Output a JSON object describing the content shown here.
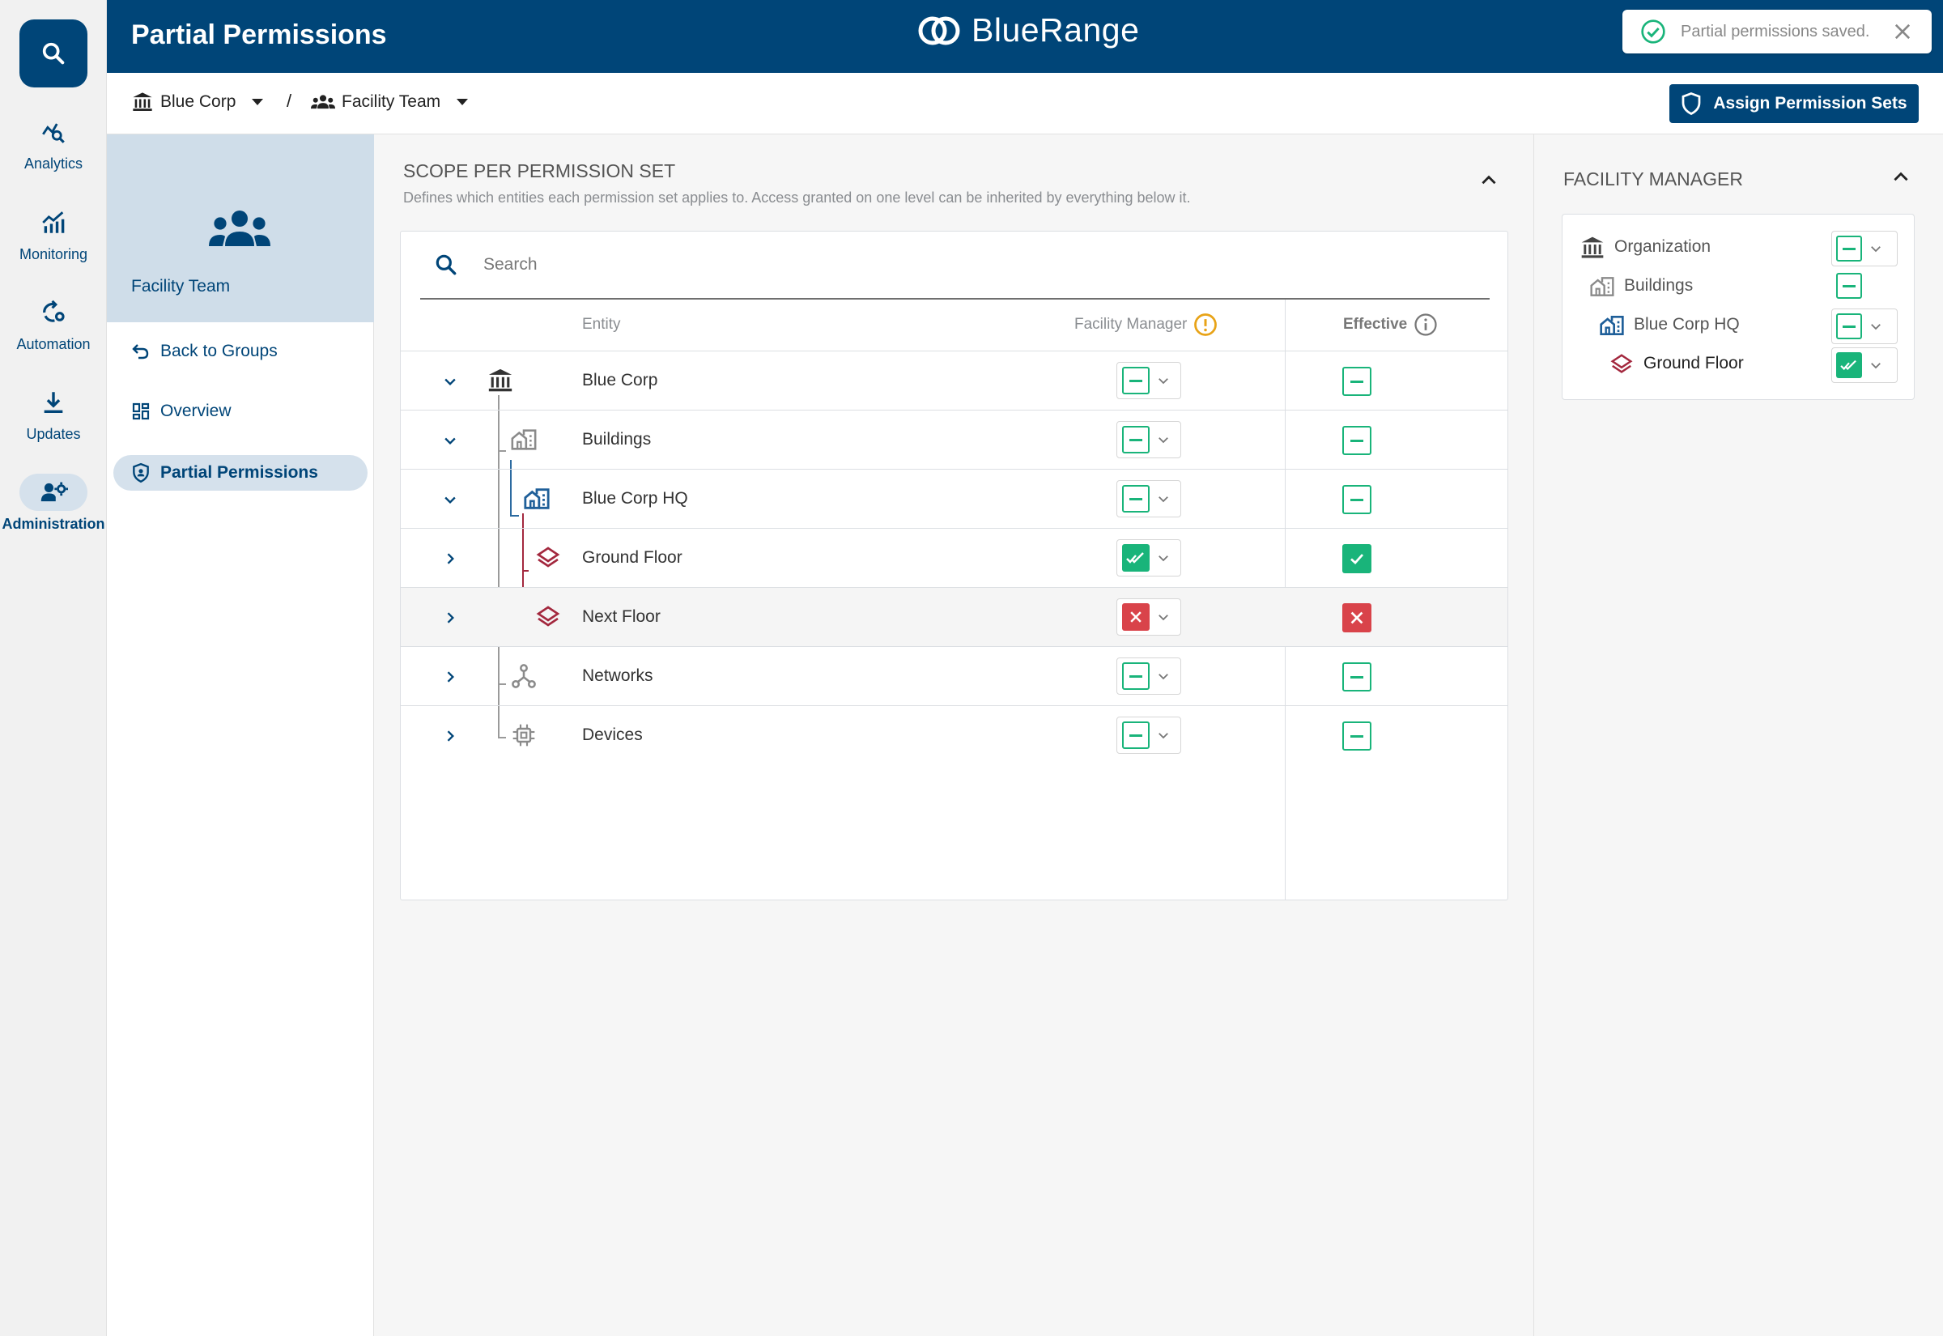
{
  "header": {
    "title": "Partial Permissions",
    "brand": "BlueRange",
    "toast": "Partial permissions saved."
  },
  "rail": {
    "items": [
      {
        "label": "Analytics",
        "icon": "analytics-icon"
      },
      {
        "label": "Monitoring",
        "icon": "monitoring-icon"
      },
      {
        "label": "Automation",
        "icon": "automation-icon"
      },
      {
        "label": "Updates",
        "icon": "download-icon"
      },
      {
        "label": "Administration",
        "icon": "admin-icon",
        "active": true
      }
    ]
  },
  "breadcrumb": {
    "org": "Blue Corp",
    "separator": "/",
    "group": "Facility Team"
  },
  "assign_button": "Assign Permission Sets",
  "subnav": {
    "group_name": "Facility Team",
    "links": [
      {
        "label": "Back to Groups",
        "icon": "undo-icon"
      },
      {
        "label": "Overview",
        "icon": "dashboard-icon"
      },
      {
        "label": "Partial Permissions",
        "icon": "shield-icon",
        "active": true
      }
    ]
  },
  "scope": {
    "title": "SCOPE PER PERMISSION SET",
    "description": "Defines which entities each permission set applies to. Access granted on one level can be inherited by everything below it.",
    "search_placeholder": "Search",
    "columns": {
      "entity": "Entity",
      "permission_set": "Facility Manager",
      "effective": "Effective"
    },
    "rows": [
      {
        "label": "Blue Corp",
        "icon": "organization-icon",
        "expanded": true,
        "setting": "partial",
        "effective": "partial"
      },
      {
        "label": "Buildings",
        "icon": "buildings-icon",
        "expanded": true,
        "setting": "partial",
        "effective": "partial"
      },
      {
        "label": "Blue Corp HQ",
        "icon": "building-icon",
        "expanded": true,
        "setting": "partial",
        "effective": "partial"
      },
      {
        "label": "Ground Floor",
        "icon": "floor-layers-icon",
        "expanded": false,
        "setting": "full",
        "effective": "full"
      },
      {
        "label": "Next Floor",
        "icon": "floor-layers-icon",
        "expanded": false,
        "setting": "denied",
        "effective": "denied"
      },
      {
        "label": "Networks",
        "icon": "network-icon",
        "expanded": false,
        "setting": "partial",
        "effective": "partial"
      },
      {
        "label": "Devices",
        "icon": "chip-icon",
        "expanded": false,
        "setting": "partial",
        "effective": "partial"
      }
    ]
  },
  "side_panel": {
    "title": "FACILITY MANAGER",
    "rows": [
      {
        "label": "Organization",
        "icon": "organization-icon",
        "state": "partial",
        "has_dropdown": true
      },
      {
        "label": "Buildings",
        "icon": "buildings-icon",
        "state": "partial",
        "has_dropdown": false
      },
      {
        "label": "Blue Corp HQ",
        "icon": "building-icon",
        "state": "partial",
        "has_dropdown": true
      },
      {
        "label": "Ground Floor",
        "icon": "floor-layers-icon",
        "state": "full",
        "has_dropdown": true
      }
    ]
  },
  "colors": {
    "navy": "#004578",
    "green": "#19b47a",
    "red": "#d9434a",
    "warning": "#e8a317",
    "maroon": "#a3283e"
  }
}
